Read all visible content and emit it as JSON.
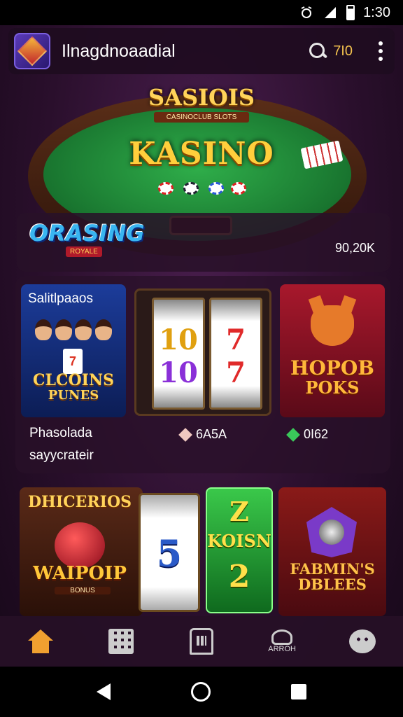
{
  "status_bar": {
    "time": "1:30"
  },
  "app_bar": {
    "title": "Ilnagdnoaadial",
    "search_value": "7I0"
  },
  "hero": {
    "badge_title": "SASIOIS",
    "badge_tag": "CASINOCLUB SLOTS",
    "title": "KASINO"
  },
  "featured": {
    "logo": "ORASING",
    "logo_tag": "ROYALE",
    "count": "90,20K"
  },
  "games": {
    "tile1": {
      "heading": "Salitlpaaos",
      "label_line1": "CLCOINS",
      "label_line2": "PUNES"
    },
    "tile2": {
      "reel1_top": "10",
      "reel1_bottom": "10",
      "reel2_top": "7",
      "reel2_bottom": "7"
    },
    "tile3": {
      "label_line1": "HOPOB",
      "label_line2": "POKS"
    },
    "caption_line1": "Phasolada",
    "caption_line2": "sayycrateir",
    "price1": "6A5A",
    "price2": "0I62"
  },
  "games_row2": {
    "tile4": {
      "top": "DHICERIOS",
      "bottom": "WAIPOIP",
      "small": "BONUS"
    },
    "tile5": {
      "value": "5"
    },
    "tile6": {
      "line1": "Z",
      "line2": "KOISN",
      "line3": "2"
    },
    "tile7": {
      "line1": "FABMIN'S",
      "line2": "DBLEES"
    }
  },
  "bottom_nav": {
    "item4_label": "ARROH"
  },
  "colors": {
    "accent_gold": "#ffcf3c",
    "felt_green": "#1c7d33",
    "background": "#2a0f2c"
  },
  "icons": [
    "home-icon",
    "grid-icon",
    "building-icon",
    "profile-icon",
    "chat-icon",
    "search-icon",
    "menu-icon"
  ]
}
